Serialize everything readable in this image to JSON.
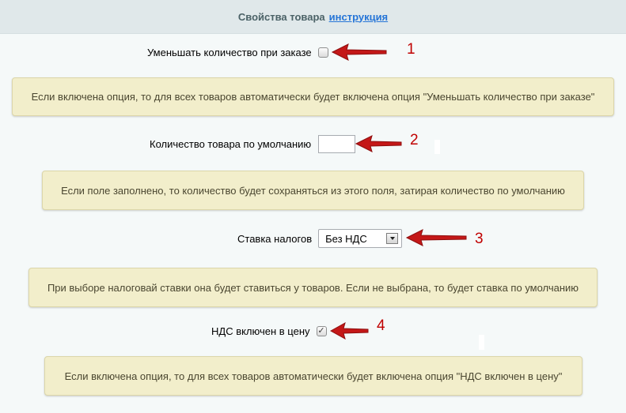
{
  "header": {
    "title": "Свойства товара",
    "link": "инструкция"
  },
  "fields": {
    "reduce_qty": {
      "label": "Уменьшать количество при заказе",
      "checked": false
    },
    "default_qty": {
      "label": "Количество товара по умолчанию",
      "value": ""
    },
    "tax_rate": {
      "label": "Ставка налогов",
      "selected": "Без НДС"
    },
    "vat_included": {
      "label": "НДС включен в цену",
      "checked": true
    }
  },
  "notes": {
    "n1": "Если включена опция, то для всех товаров автоматически будет включена опция \"Уменьшать количество при заказе\"",
    "n2": "Если поле заполнено, то количество будет сохраняться из этого поля, затирая количество по умолчанию",
    "n3": "При выборе налоговай ставки она будет ставиться у товаров. Если не выбрана, то будет ставка по умолчанию",
    "n4": "Если включена опция, то для всех товаров автоматически будет включена опция \"НДС включен в цену\""
  },
  "annotations": {
    "num1": "1",
    "num2": "2",
    "num3": "3",
    "num4": "4",
    "arrow_color": "#c41818"
  },
  "icons": {
    "checkbox_checked": "✓"
  }
}
